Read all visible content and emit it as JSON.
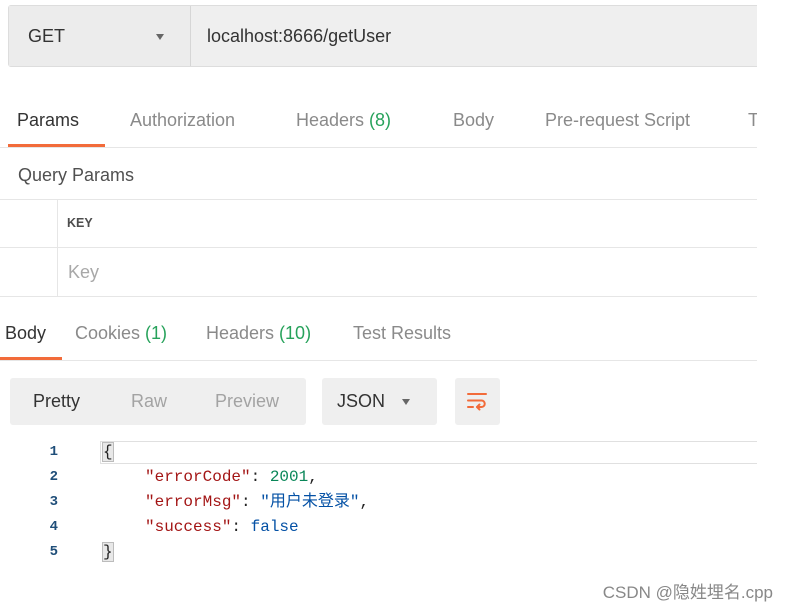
{
  "request": {
    "method": "GET",
    "method_icon": "chevron-down-icon",
    "url": "localhost:8666/getUser"
  },
  "request_tabs": [
    {
      "label": "Params",
      "active": true
    },
    {
      "label": "Authorization",
      "active": false
    },
    {
      "label": "Headers",
      "count": "(8)",
      "active": false
    },
    {
      "label": "Body",
      "active": false
    },
    {
      "label": "Pre-request Script",
      "active": false
    },
    {
      "label": "T",
      "active": false
    }
  ],
  "query_params": {
    "title": "Query Params",
    "key_header": "KEY",
    "key_placeholder": "Key"
  },
  "response_tabs": [
    {
      "label": "Body",
      "active": true
    },
    {
      "label": "Cookies",
      "count": "(1)",
      "active": false
    },
    {
      "label": "Headers",
      "count": "(10)",
      "active": false
    },
    {
      "label": "Test Results",
      "active": false
    }
  ],
  "response_toolbar": {
    "view_modes": [
      {
        "label": "Pretty",
        "active": true
      },
      {
        "label": "Raw",
        "active": false
      },
      {
        "label": "Preview",
        "active": false
      }
    ],
    "format": "JSON",
    "format_icon": "chevron-down-icon",
    "wrap_icon": "wrap-lines-icon"
  },
  "response_body": {
    "lines": [
      {
        "number": "1",
        "text": "{"
      },
      {
        "number": "2",
        "key": "\"errorCode\"",
        "colon": ": ",
        "value": "2001",
        "comma": ","
      },
      {
        "number": "3",
        "key": "\"errorMsg\"",
        "colon": ": ",
        "value": "\"用户未登录\"",
        "comma": ","
      },
      {
        "number": "4",
        "key": "\"success\"",
        "colon": ": ",
        "value": "false"
      },
      {
        "number": "5",
        "text": "}"
      }
    ]
  },
  "watermark": "CSDN @隐姓埋名.cpp",
  "colors": {
    "accent": "#f26b3a",
    "count_green": "#27a25b",
    "json_key": "#a31515",
    "json_string": "#0451a5",
    "json_number": "#098658",
    "json_boolean": "#0451a5",
    "line_number": "#1f4e79"
  }
}
